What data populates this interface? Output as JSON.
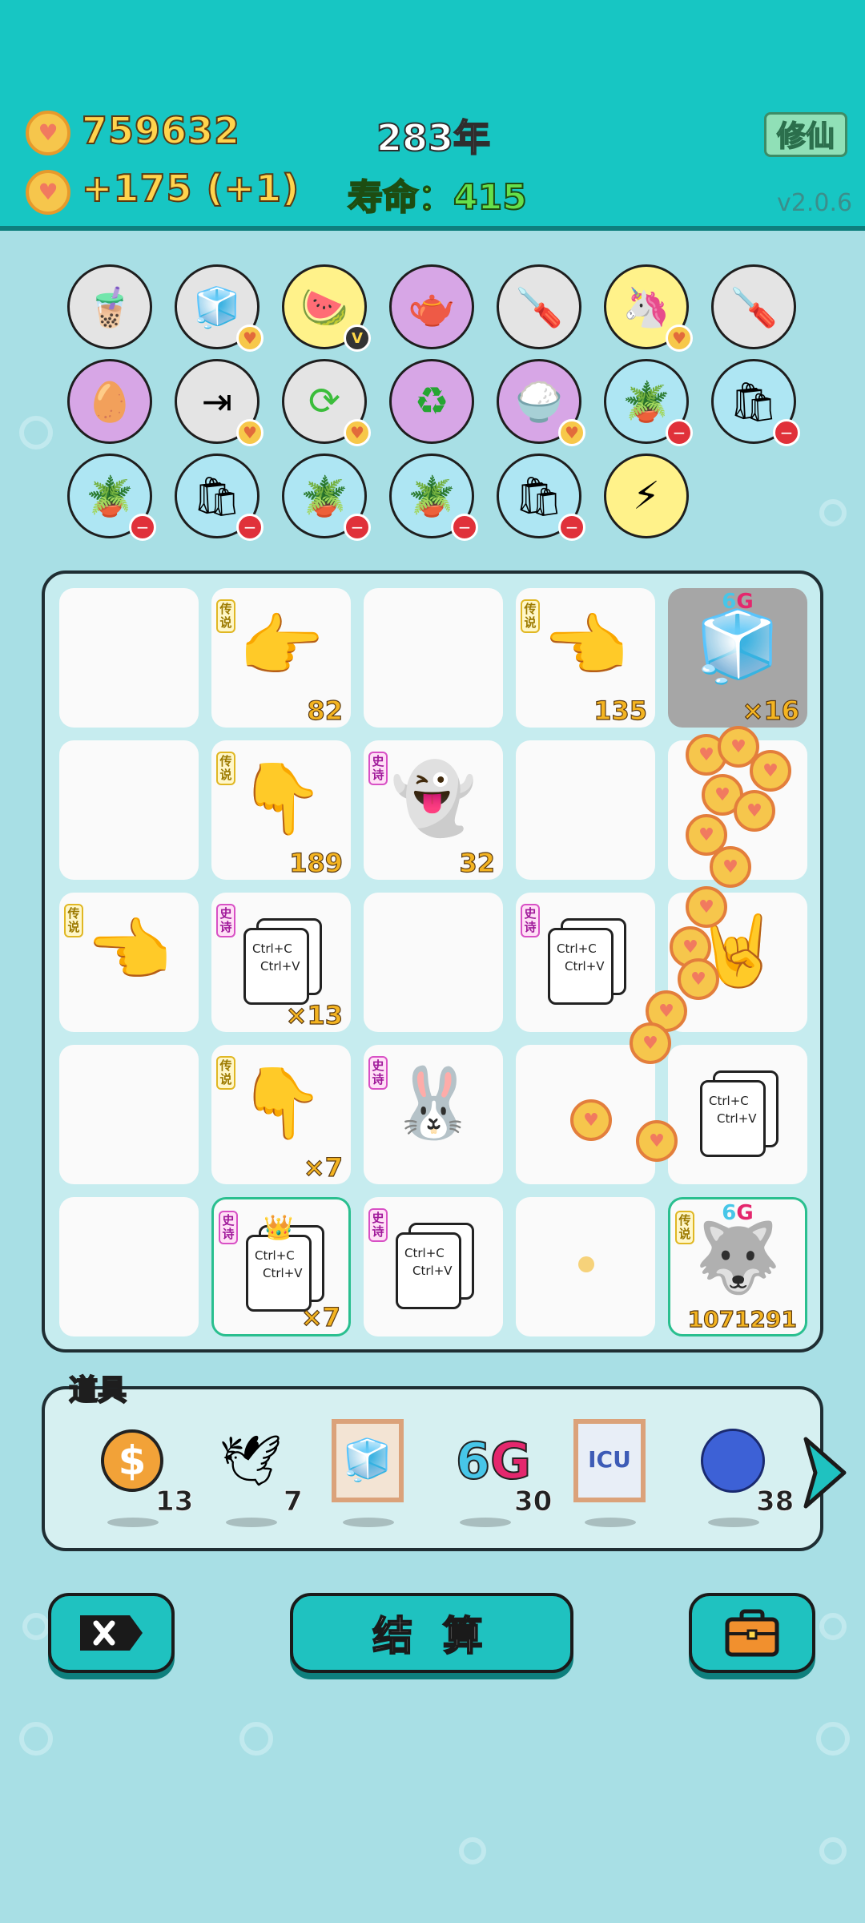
{
  "header": {
    "coins": "759632",
    "income": "+175 (+1)",
    "year": "283年",
    "lifespan": "寿命：415",
    "cultivate_button": "修仙",
    "version": "v2.0.6"
  },
  "perks": {
    "row1": [
      "bubble-tea-icon",
      "sugar-cubes-icon",
      "fruit-bowl-icon",
      "gravy-boat-icon",
      "screwdriver-icon",
      "unicorn-icon",
      "screwdriver-icon"
    ],
    "row2": [
      "egg-icon",
      "skip-icon",
      "refresh-icon",
      "recycle-icon",
      "rice-bowl-icon",
      "flower-pot-icon",
      "trash-bag-icon"
    ],
    "row3": [
      "flower-pot-icon",
      "trash-bag-icon",
      "flower-pot-icon",
      "flower-pot-icon",
      "trash-bag-icon",
      "lightning-icon"
    ]
  },
  "tags": {
    "legendary": "传说",
    "epic": "史诗"
  },
  "board": {
    "r1": {
      "c2": "82",
      "c4": "135",
      "c5_label": "6G",
      "c5": "×16"
    },
    "r2": {
      "c2": "189",
      "c3": "32"
    },
    "r3": {
      "c2": "×13"
    },
    "r4": {
      "c2": "×7"
    },
    "r5": {
      "c2": "×7",
      "c5_label": "6G",
      "c5": "1071291"
    },
    "copy_text_1": "Ctrl+C",
    "copy_text_2": "Ctrl+V"
  },
  "items_bar": {
    "title": "道具",
    "items": [
      {
        "icon": "dollar-coin-icon",
        "qty": "13"
      },
      {
        "icon": "pigeon-icon",
        "qty": "7"
      },
      {
        "icon": "fridge-frame-icon",
        "qty": ""
      },
      {
        "icon": "6g-icon",
        "label": "6G",
        "qty": "30"
      },
      {
        "icon": "icu-frame-icon",
        "label": "ICU",
        "qty": ""
      },
      {
        "icon": "blueberry-icon",
        "qty": "38"
      }
    ]
  },
  "buttons": {
    "settle": "结 算"
  },
  "colors": {
    "header": "#17c6c3",
    "background": "#a8dfe5",
    "coin_text": "#ffd44d",
    "lifespan": "#64e04b"
  }
}
